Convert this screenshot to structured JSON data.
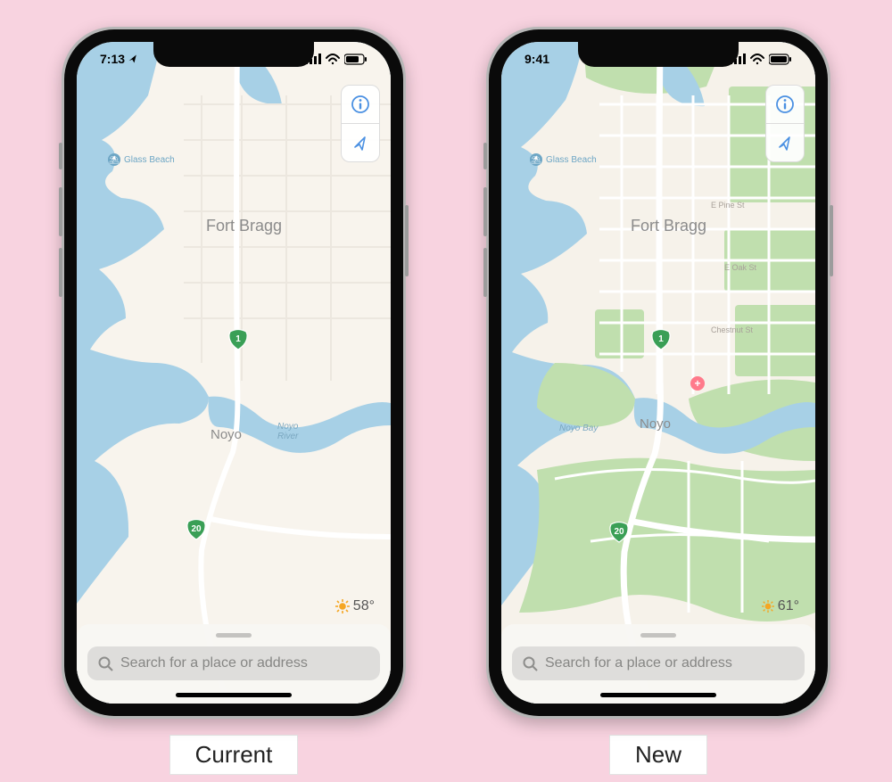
{
  "captions": {
    "left": "Current",
    "right": "New"
  },
  "phones": {
    "left": {
      "status": {
        "time": "7:13"
      },
      "weather": {
        "temp": "58°"
      },
      "search": {
        "placeholder": "Search for a place or address"
      },
      "labels": {
        "city1": "Fort Bragg",
        "city2": "Noyo",
        "river": "Noyo\nRiver",
        "poi_glass": "Glass Beach"
      },
      "shields": {
        "hwy1": "1",
        "hwy20": "20"
      }
    },
    "right": {
      "status": {
        "time": "9:41"
      },
      "weather": {
        "temp": "61°"
      },
      "search": {
        "placeholder": "Search for a place or address"
      },
      "labels": {
        "city1": "Fort Bragg",
        "city2": "Noyo",
        "bay": "Noyo Bay",
        "poi_glass": "Glass Beach",
        "st_pine": "E Pine St",
        "st_oak": "E Oak St",
        "st_chestnut": "Chestnut St"
      },
      "shields": {
        "hwy1": "1",
        "hwy20": "20"
      }
    }
  }
}
